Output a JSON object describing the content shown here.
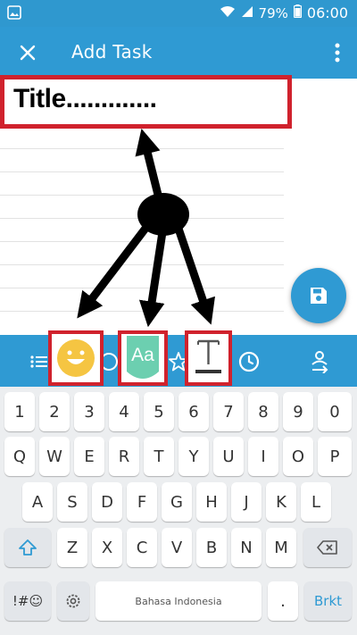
{
  "status_bar": {
    "battery": "79%",
    "time": "06:00"
  },
  "toolbar": {
    "title": "Add Task"
  },
  "note": {
    "title_placeholder": "Title............."
  },
  "format_bar": {
    "font_button_label": "Aa"
  },
  "keyboard": {
    "number_row": [
      "1",
      "2",
      "3",
      "4",
      "5",
      "6",
      "7",
      "8",
      "9",
      "0"
    ],
    "row1": [
      "Q",
      "W",
      "E",
      "R",
      "T",
      "Y",
      "U",
      "I",
      "O",
      "P"
    ],
    "row2": [
      "A",
      "S",
      "D",
      "F",
      "G",
      "H",
      "J",
      "K",
      "L"
    ],
    "row3": [
      "Z",
      "X",
      "C",
      "V",
      "B",
      "N",
      "M"
    ],
    "symbols_label": "!#☺",
    "period_label": ".",
    "space_label": "Bahasa Indonesia",
    "enter_label": "Brkt"
  },
  "colors": {
    "accent": "#2f9ad3",
    "highlight": "#d0222d",
    "emoji": "#f5c542",
    "font_tile": "#6ccfb0"
  }
}
